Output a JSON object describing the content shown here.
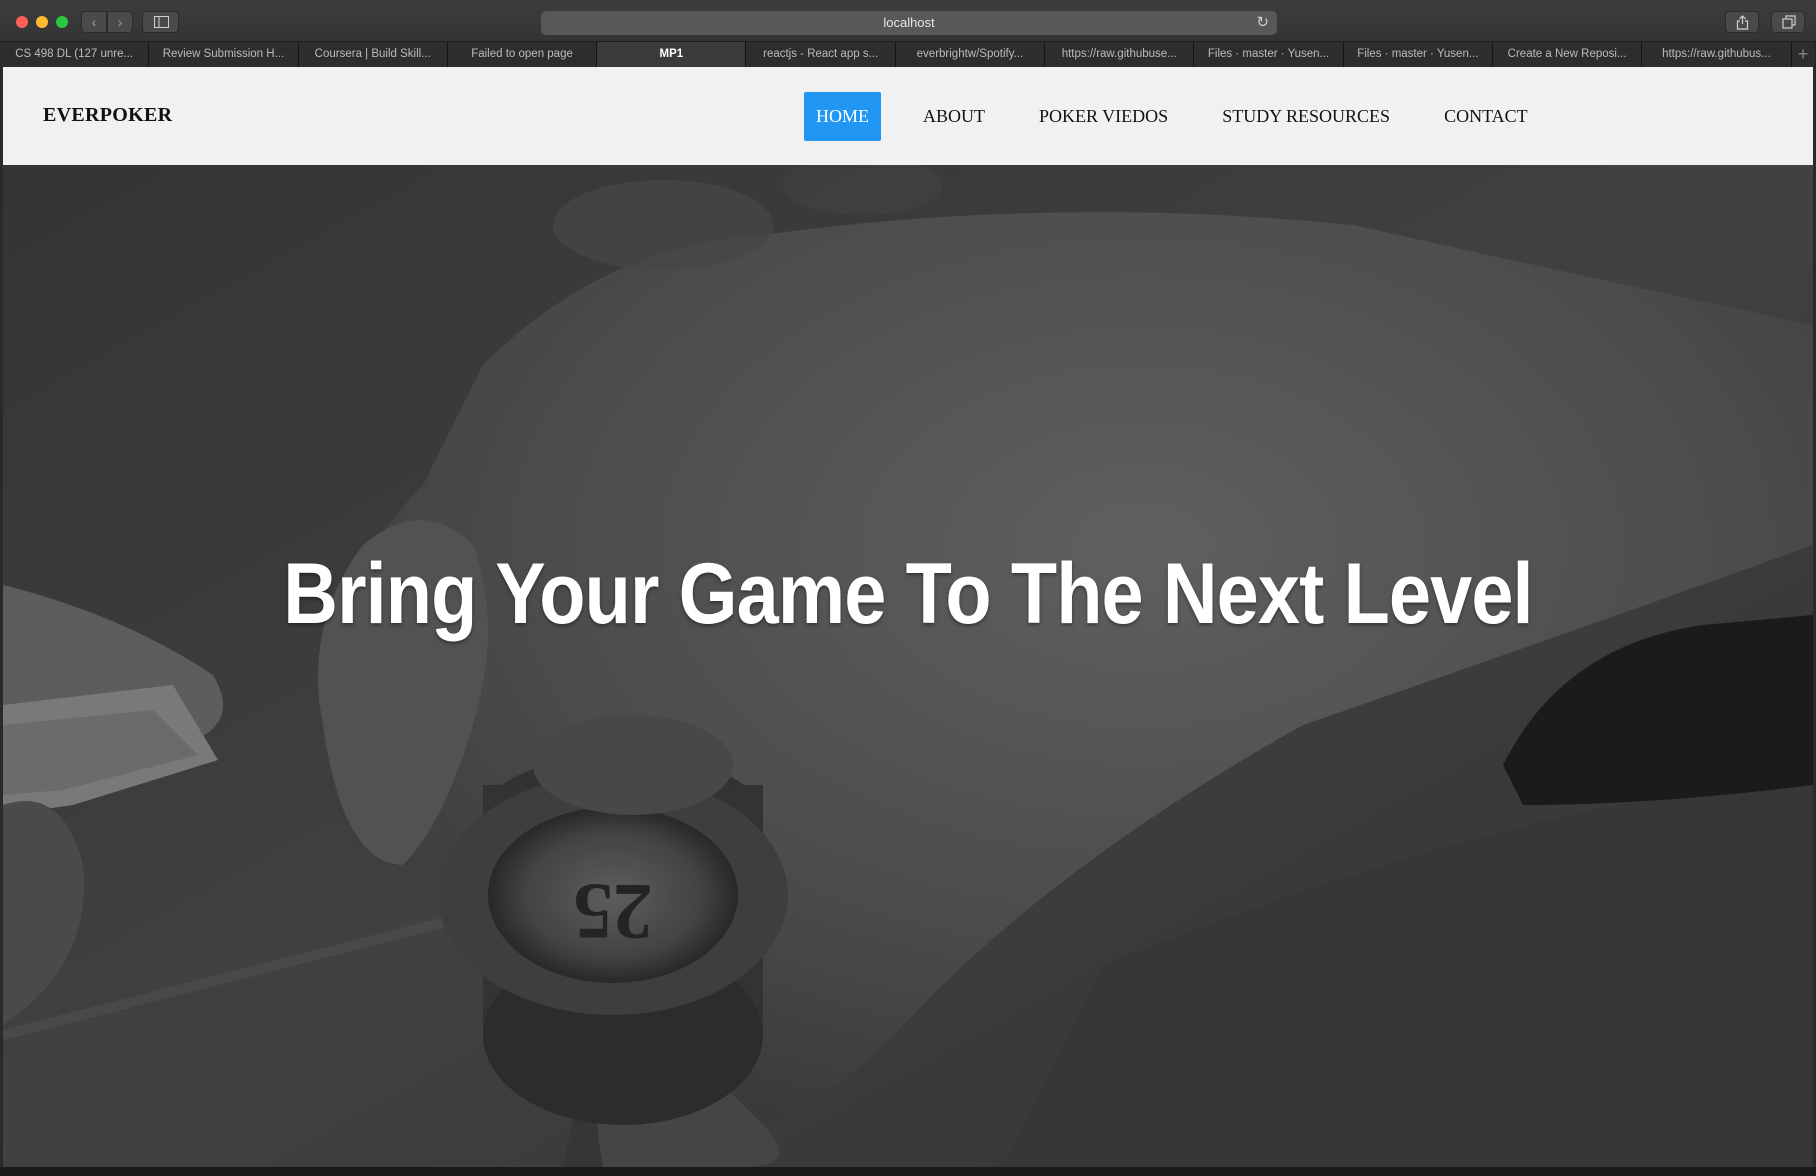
{
  "browser": {
    "url": "localhost",
    "tabs": [
      {
        "label": "CS 498 DL (127 unre...",
        "active": false
      },
      {
        "label": "Review Submission H...",
        "active": false
      },
      {
        "label": "Coursera | Build Skill...",
        "active": false
      },
      {
        "label": "Failed to open page",
        "active": false
      },
      {
        "label": "MP1",
        "active": true
      },
      {
        "label": "reactjs - React app s...",
        "active": false
      },
      {
        "label": "everbrightw/Spotify...",
        "active": false
      },
      {
        "label": "https://raw.githubuse...",
        "active": false
      },
      {
        "label": "Files · master · Yusen...",
        "active": false
      },
      {
        "label": "Files · master · Yusen...",
        "active": false
      },
      {
        "label": "Create a New Reposi...",
        "active": false
      },
      {
        "label": "https://raw.githubus...",
        "active": false
      }
    ]
  },
  "site": {
    "brand": "EVERPOKER",
    "nav": [
      {
        "label": "HOME",
        "active": true
      },
      {
        "label": "ABOUT",
        "active": false
      },
      {
        "label": "POKER VIEDOS",
        "active": false
      },
      {
        "label": "STUDY RESOURCES",
        "active": false
      },
      {
        "label": "CONTACT",
        "active": false
      }
    ],
    "active_color": "#2196f3"
  },
  "hero": {
    "title": "Bring Your Game To The Next Level"
  }
}
